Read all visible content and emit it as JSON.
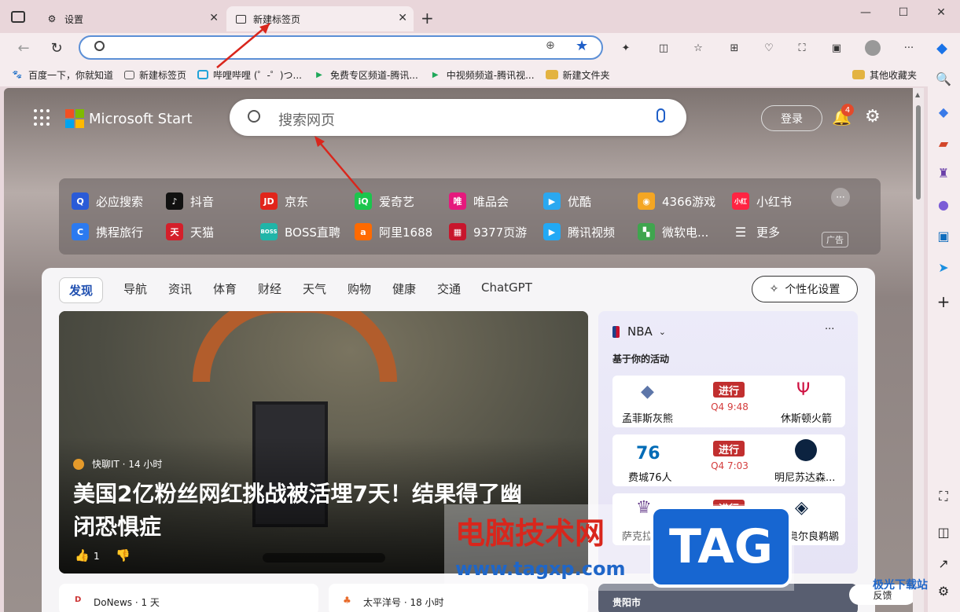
{
  "tabs": [
    {
      "label": "设置"
    },
    {
      "label": "新建标签页"
    }
  ],
  "window": {
    "minimize": "—",
    "maximize": "☐",
    "close": "✕"
  },
  "address": {
    "value": "",
    "placeholder": ""
  },
  "bookmarks": [
    {
      "label": "百度一下，你就知道",
      "color": "#2a4fd6"
    },
    {
      "label": "新建标签页",
      "color": "#555"
    },
    {
      "label": "哔哩哔哩 (゜-゜)つ...",
      "color": "#21a3d8"
    },
    {
      "label": "免费专区频道-腾讯...",
      "color": "#1fa85a"
    },
    {
      "label": "中视频频道-腾讯视...",
      "color": "#1fa85a"
    },
    {
      "label": "新建文件夹",
      "color": "#e3b341"
    }
  ],
  "other_bookmarks": "其他收藏夹",
  "page": {
    "brand": "Microsoft Start",
    "search_placeholder": "搜索网页",
    "login": "登录",
    "notif_count": "4",
    "quick_links_row1": [
      {
        "label": "必应搜索",
        "color": "#2a5bd7"
      },
      {
        "label": "抖音",
        "color": "#111"
      },
      {
        "label": "京东",
        "color": "#e1251b"
      },
      {
        "label": "爱奇艺",
        "color": "#1bc54d"
      },
      {
        "label": "唯品会",
        "color": "#e5197d"
      },
      {
        "label": "优酷",
        "color": "#2aa8f0"
      },
      {
        "label": "4366游戏",
        "color": "#f4a623"
      },
      {
        "label": "小红书",
        "color": "#ff2442"
      }
    ],
    "quick_links_row2": [
      {
        "label": "携程旅行",
        "color": "#2b7af0"
      },
      {
        "label": "天猫",
        "color": "#d41f2a"
      },
      {
        "label": "BOSS直聘",
        "color": "#20b5a8"
      },
      {
        "label": "阿里1688",
        "color": "#ff6a00"
      },
      {
        "label": "9377页游",
        "color": "#c8162c"
      },
      {
        "label": "腾讯视频",
        "color": "#22a9f5"
      },
      {
        "label": "微软电...",
        "color": "#3fa54e"
      },
      {
        "label": "更多",
        "color": "transparent"
      }
    ],
    "ad_label": "广告",
    "feed_tabs": [
      "发现",
      "导航",
      "资讯",
      "体育",
      "财经",
      "天气",
      "购物",
      "健康",
      "交通",
      "ChatGPT"
    ],
    "personalize": "个性化设置",
    "hero": {
      "source": "快聊IT · 14 小时",
      "headline_line1": "美国2亿粉丝网红挑战被活埋7天！结果得了幽",
      "headline_line2": "闭恐惧症",
      "likes": "1"
    },
    "nba": {
      "title": "NBA",
      "subtitle": "基于你的活动",
      "games": [
        {
          "home": "孟菲斯灰熊",
          "away": "休斯顿火箭",
          "status": "进行",
          "clock": "Q4 9:48"
        },
        {
          "home": "费城76人",
          "away": "明尼苏达森...",
          "status": "进行",
          "clock": "Q4 7:03"
        },
        {
          "home": "萨克拉门托...",
          "away": "新奥尔良鹈鹕",
          "status": "进行",
          "clock": ""
        }
      ]
    },
    "cards": [
      {
        "source": "DoNews · 1 天"
      },
      {
        "source": "太平洋号 · 18 小时"
      },
      {
        "source": "贵阳市"
      }
    ],
    "feedback": "反馈"
  },
  "watermark": {
    "text1": "电脑技术网",
    "text2": "www.tagxp.com",
    "tag": "TAG",
    "corner": "极光下载站"
  }
}
